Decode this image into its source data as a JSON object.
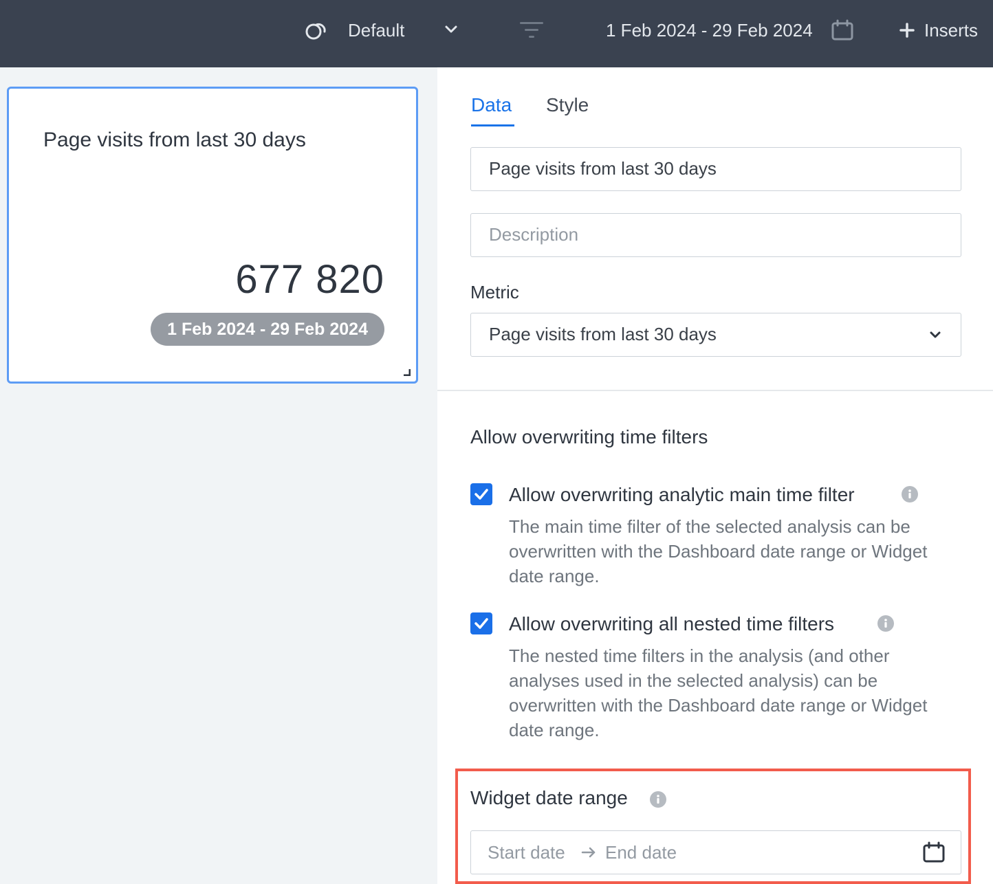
{
  "topbar": {
    "segment_icon": "segment-loop-icon",
    "segment_label": "Default",
    "dropdown_icon": "chevron-down-icon",
    "filter_icon": "filter-icon",
    "date_range": "1 Feb 2024 - 29 Feb 2024",
    "calendar_icon": "calendar-icon",
    "inserts_label": "Inserts",
    "inserts_icon": "plus-icon"
  },
  "widget": {
    "title": "Page visits from last 30 days",
    "value": "677 820",
    "date_badge": "1 Feb 2024 - 29 Feb 2024"
  },
  "panel": {
    "tabs": [
      {
        "label": "Data",
        "active": true
      },
      {
        "label": "Style",
        "active": false
      }
    ],
    "title_field_value": "Page visits from last 30 days",
    "description_placeholder": "Description",
    "metric_label": "Metric",
    "metric_selected": "Page visits from last 30 days",
    "overwrite_section_title": "Allow overwriting time filters",
    "options": [
      {
        "checked": true,
        "title": "Allow overwriting analytic main time filter",
        "description": "The main time filter of the selected analysis can be overwritten with the Dashboard date range or Widget date range."
      },
      {
        "checked": true,
        "title": "Allow overwriting all nested time filters",
        "description": "The nested time filters in the analysis (and other analyses used in the selected analysis) can be overwritten with the Dashboard date range or Widget date range."
      }
    ],
    "widget_date_range": {
      "title": "Widget date range",
      "start_placeholder": "Start date",
      "end_placeholder": "End date"
    }
  },
  "colors": {
    "topbar_bg": "#3a4250",
    "accent_blue": "#1a73e8",
    "card_border": "#5d9cf5",
    "highlight_red": "#f25c4c",
    "badge_gray": "#969ba2"
  }
}
